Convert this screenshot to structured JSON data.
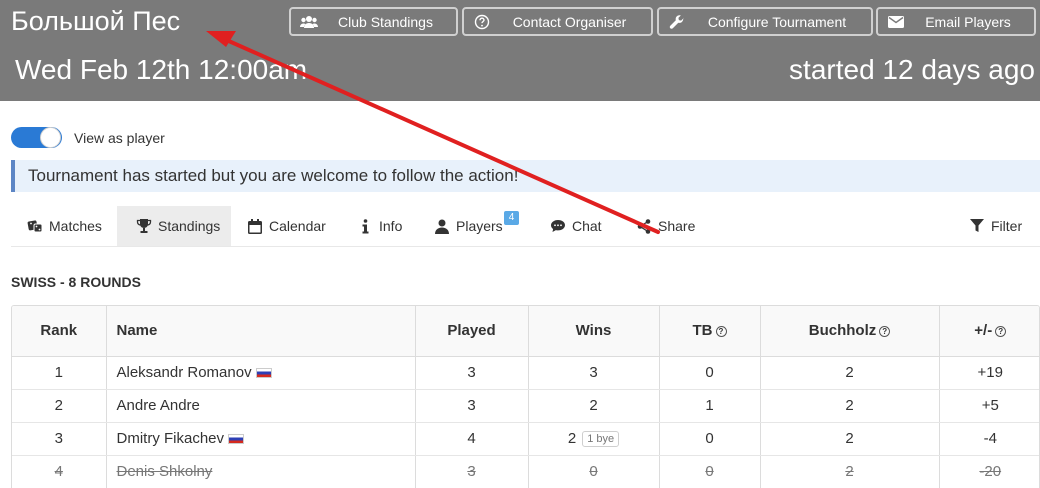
{
  "header": {
    "title": "Большой Пес",
    "date": "Wed Feb 12th 12:00am",
    "status": "started 12 days ago",
    "buttons": {
      "club_standings": "Club Standings",
      "contact_organiser": "Contact Organiser",
      "configure_tournament": "Configure Tournament",
      "email_players": "Email Players"
    }
  },
  "toggle": {
    "label": "View as player",
    "on": true
  },
  "banner": "Tournament has started but you are welcome to follow the action!",
  "tabs": {
    "matches": "Matches",
    "standings": "Standings",
    "calendar": "Calendar",
    "info": "Info",
    "players": "Players",
    "players_badge": "4",
    "chat": "Chat",
    "share": "Share",
    "filter": "Filter"
  },
  "section_title": "SWISS - 8 ROUNDS",
  "table": {
    "headers": {
      "rank": "Rank",
      "name": "Name",
      "played": "Played",
      "wins": "Wins",
      "tb": "TB",
      "buchholz": "Buchholz",
      "diff": "+/-"
    },
    "rows": [
      {
        "rank": "1",
        "name": "Aleksandr Romanov",
        "flag": "ru",
        "played": "3",
        "wins": "3",
        "bye": "",
        "tb": "0",
        "buchholz": "2",
        "diff": "+19",
        "withdrawn": false
      },
      {
        "rank": "2",
        "name": "Andre Andre",
        "flag": "",
        "played": "3",
        "wins": "2",
        "bye": "",
        "tb": "1",
        "buchholz": "2",
        "diff": "+5",
        "withdrawn": false
      },
      {
        "rank": "3",
        "name": "Dmitry Fikachev",
        "flag": "ru",
        "played": "4",
        "wins": "2",
        "bye": "1 bye",
        "tb": "0",
        "buchholz": "2",
        "diff": "-4",
        "withdrawn": false
      },
      {
        "rank": "4",
        "name": "Denis Shkolny",
        "flag": "",
        "played": "3",
        "wins": "0",
        "bye": "",
        "tb": "0",
        "buchholz": "2",
        "diff": "-20",
        "withdrawn": true
      }
    ]
  },
  "colors": {
    "header_bg": "#7a7a7a",
    "toggle_on": "#2a7ad5",
    "banner_bg": "#e8f1fb",
    "banner_border": "#5d86c5",
    "badge": "#5aa9e6",
    "annotation_arrow": "#e02020"
  },
  "icons": {
    "club_standings": "users-icon",
    "contact_organiser": "question-circle-icon",
    "configure_tournament": "wrench-icon",
    "email_players": "envelope-icon"
  }
}
